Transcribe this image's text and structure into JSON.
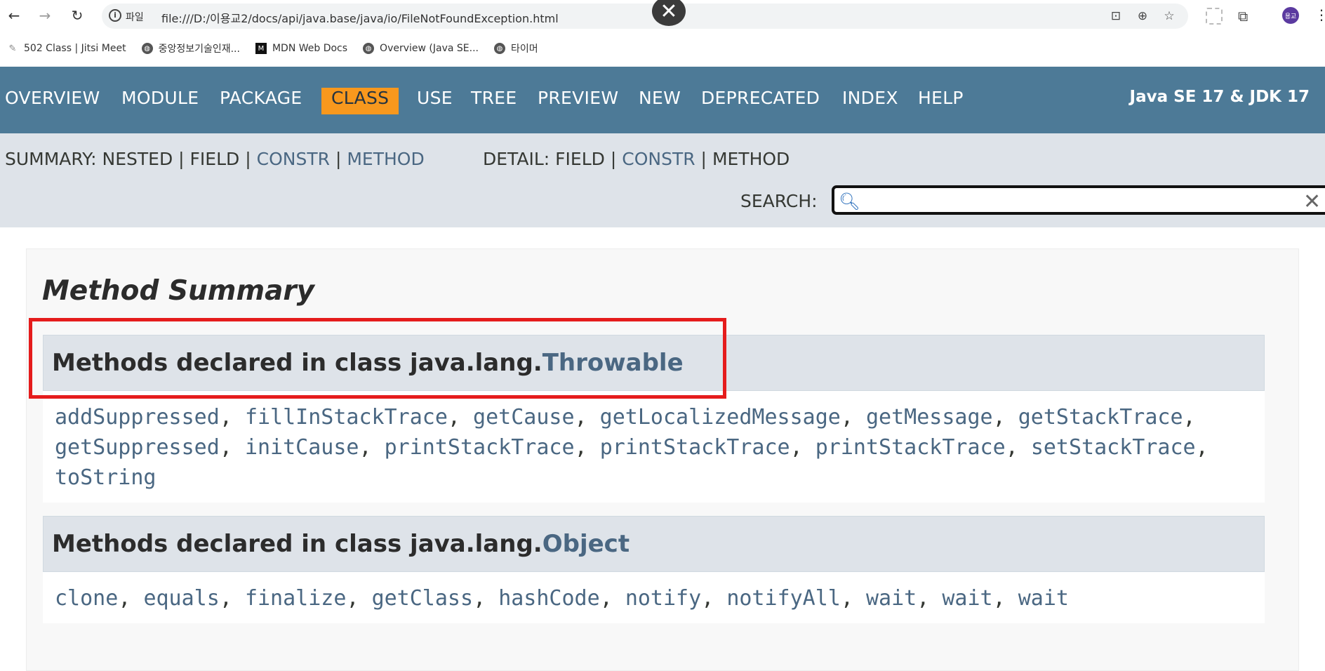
{
  "browser": {
    "url_scheme_label": "파일",
    "url": "file:///D:/이용교2/docs/api/java.base/java/io/FileNotFoundException.html",
    "avatar_text": "용교",
    "bookmarks": [
      {
        "label": "502 Class | Jitsi Meet",
        "icon": "jitsi-icon"
      },
      {
        "label": "중앙정보기술인재...",
        "icon": "globe-icon"
      },
      {
        "label": "MDN Web Docs",
        "icon": "mdn-icon"
      },
      {
        "label": "Overview (Java SE...",
        "icon": "globe-icon"
      },
      {
        "label": "타이머",
        "icon": "globe-icon"
      }
    ]
  },
  "topnav": {
    "items": [
      "OVERVIEW",
      "MODULE",
      "PACKAGE",
      "CLASS",
      "USE",
      "TREE",
      "PREVIEW",
      "NEW",
      "DEPRECATED",
      "INDEX",
      "HELP"
    ],
    "active": "CLASS",
    "about": "Java SE 17 & JDK 17"
  },
  "subnav": {
    "summary_label": "SUMMARY:",
    "summary_nested": "NESTED",
    "summary_field": "FIELD",
    "summary_constr": "CONSTR",
    "summary_method": "METHOD",
    "detail_label": "DETAIL:",
    "detail_field": "FIELD",
    "detail_constr": "CONSTR",
    "detail_method": "METHOD",
    "separator": "|",
    "search_label": "SEARCH:",
    "search_value": "",
    "search_clear": "✕"
  },
  "content": {
    "section_title": "Method Summary",
    "throwable": {
      "prefix": "Methods declared in class java.lang.",
      "class_name": "Throwable",
      "methods": [
        "addSuppressed",
        "fillInStackTrace",
        "getCause",
        "getLocalizedMessage",
        "getMessage",
        "getStackTrace",
        "getSuppressed",
        "initCause",
        "printStackTrace",
        "printStackTrace",
        "printStackTrace",
        "setStackTrace",
        "toString"
      ]
    },
    "object": {
      "prefix": "Methods declared in class java.lang.",
      "class_name": "Object",
      "methods": [
        "clone",
        "equals",
        "finalize",
        "getClass",
        "hashCode",
        "notify",
        "notifyAll",
        "wait",
        "wait",
        "wait"
      ]
    }
  },
  "colors": {
    "nav_bg": "#4d7a97",
    "active_tab": "#f8981d",
    "subnav_bg": "#dee3e9",
    "link": "#4a6782",
    "highlight_box": "#e51c1c"
  }
}
